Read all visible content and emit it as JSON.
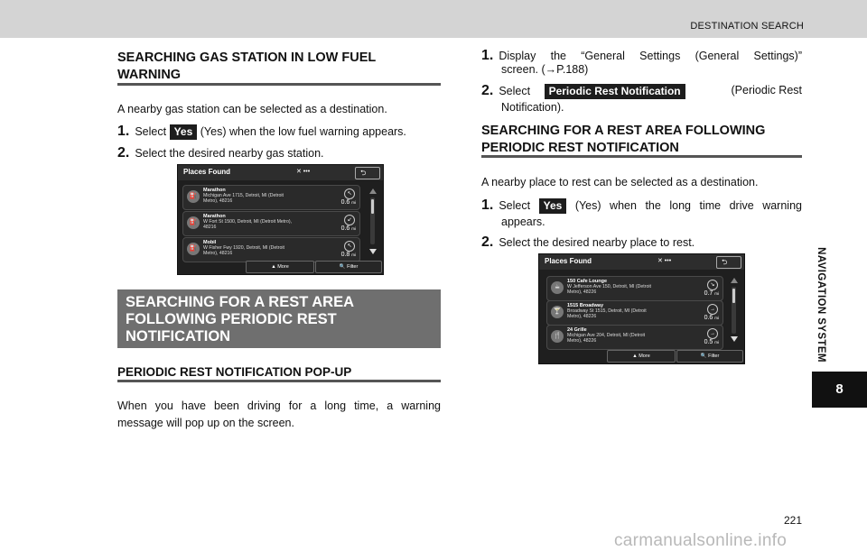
{
  "header": {
    "section_title": "DESTINATION SEARCH"
  },
  "side": {
    "label": "NAVIGATION SYSTEM",
    "chapter": "8"
  },
  "page_number": "221",
  "watermark": "carmanualsonline.info",
  "left": {
    "heading1": "SEARCHING GAS STATION IN LOW FUEL WARNING",
    "intro": "A nearby gas station can be selected as a destination.",
    "step1": {
      "num": "1.",
      "pre": "Select",
      "badge": "Yes",
      "post": "(Yes) when the low fuel warning appears."
    },
    "step2": {
      "num": "2.",
      "text": "Select the desired nearby gas station."
    },
    "gray_heading": "SEARCHING FOR A REST AREA FOLLOWING PERIODIC REST NOTIFICATION",
    "heading2": "PERIODIC REST NOTIFICATION POP-UP",
    "para_line1": "When you have been driving for a long time, a warning",
    "para_line2": "message will pop up on the screen."
  },
  "right": {
    "step1": {
      "num": "1.",
      "line1": "Display the “General Settings (General Settings)”",
      "line2": "screen. (→P.188)"
    },
    "step2": {
      "num": "2.",
      "pre": "Select",
      "badge": "Periodic Rest Notification",
      "post": "(Periodic Rest",
      "line2": "Notification)."
    },
    "heading": "SEARCHING FOR A REST AREA FOLLOWING PERIODIC REST NOTIFICATION",
    "intro": "A nearby place to rest can be selected as a destination.",
    "step3": {
      "num": "1.",
      "pre": "Select",
      "badge": "Yes",
      "post": "(Yes) when the long time drive warning",
      "line2": "appears."
    },
    "step4": {
      "num": "2.",
      "text": "Select the desired nearby place to rest."
    }
  },
  "screen1": {
    "title": "Places Found",
    "status": "✕ •••",
    "more": "More",
    "filter": "Filter",
    "items": [
      {
        "name": "Marathon",
        "addr1": "Michigan Ave 1715, Detroit, MI (Detroit",
        "addr2": "Metro), 48216",
        "dist": "0.6",
        "unit": "mi"
      },
      {
        "name": "Marathon",
        "addr1": "W Fort St 1500, Detroit, MI (Detroit Metro),",
        "addr2": "48216",
        "dist": "0.6",
        "unit": "mi"
      },
      {
        "name": "Mobil",
        "addr1": "W Fisher Fwy 1920, Detroit, MI (Detroit",
        "addr2": "Metro), 48216",
        "dist": "0.8",
        "unit": "mi"
      }
    ]
  },
  "screen2": {
    "title": "Places Found",
    "status": "✕ •••",
    "more": "More",
    "filter": "Filter",
    "items": [
      {
        "name": "150 Cafe Lounge",
        "addr1": "W Jefferson Ave 150, Detroit, MI (Detroit",
        "addr2": "Metro), 48226",
        "dist": "0.7",
        "unit": "mi"
      },
      {
        "name": "1515 Broadway",
        "addr1": "Broadway St 1515, Detroit, MI (Detroit",
        "addr2": "Metro), 48226",
        "dist": "0.6",
        "unit": "mi"
      },
      {
        "name": "24 Grille",
        "addr1": "Michigan Ave 204, Detroit, MI (Detroit",
        "addr2": "Metro), 48226",
        "dist": "0.5",
        "unit": "mi"
      }
    ]
  }
}
